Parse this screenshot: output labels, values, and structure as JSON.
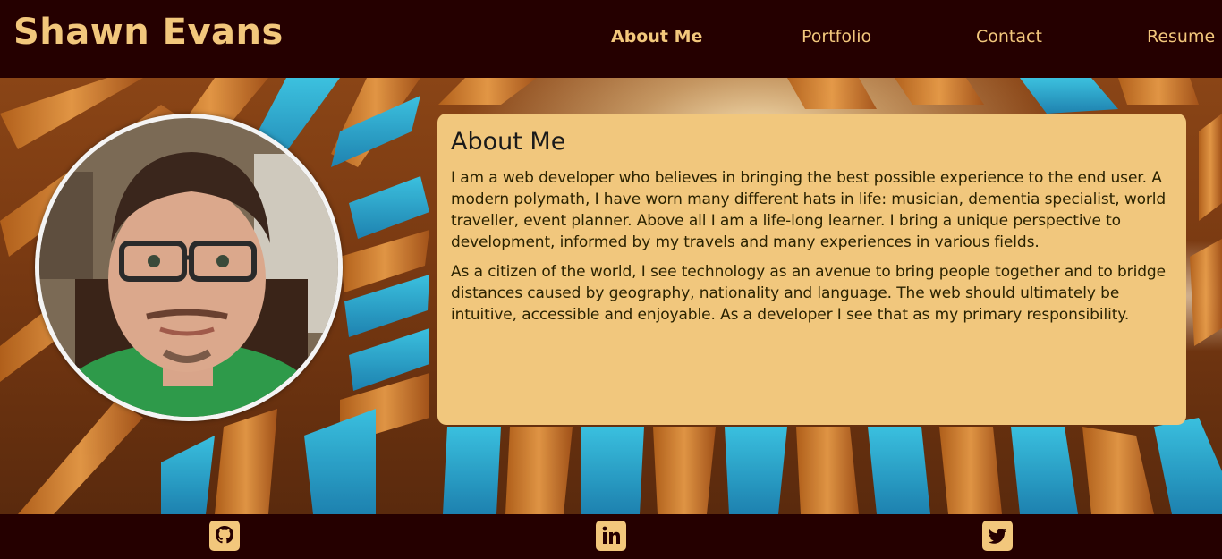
{
  "site": {
    "title": "Shawn Evans"
  },
  "nav": {
    "items": [
      {
        "label": "About Me",
        "active": true
      },
      {
        "label": "Portfolio",
        "active": false
      },
      {
        "label": "Contact",
        "active": false
      },
      {
        "label": "Resume",
        "active": false
      }
    ]
  },
  "about": {
    "heading": "About Me",
    "paragraphs": [
      "I am a web developer who believes in bringing the best possible experience to the end user. A modern polymath, I have worn many different hats in life: musician, dementia specialist, world traveller, event planner. Above all I am a life-long learner. I bring a unique perspective to development, informed by my travels and many experiences in various fields.",
      "As a citizen of the world, I see technology as an avenue to bring people together and to bridge distances caused by geography, nationality and language. The web should ultimately be intuitive, accessible and enjoyable. As a developer I see that as my primary responsibility."
    ]
  },
  "footer": {
    "social": [
      {
        "icon": "github-icon"
      },
      {
        "icon": "linkedin-icon"
      },
      {
        "icon": "twitter-icon"
      }
    ]
  },
  "colors": {
    "header_bg": "#250000",
    "accent": "#f2c77c",
    "card_bg": "#f1c77d",
    "text": "#1a1a1a"
  }
}
